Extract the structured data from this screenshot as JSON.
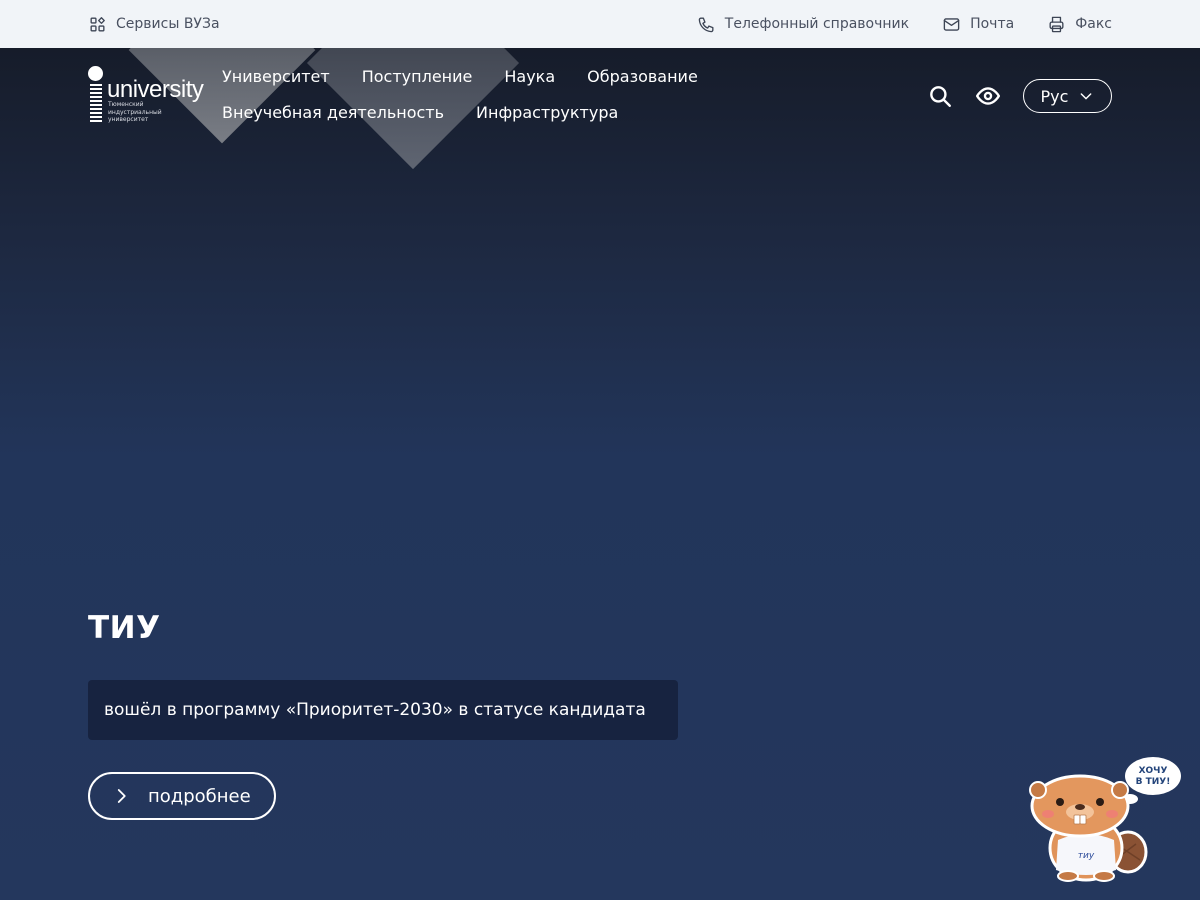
{
  "topbar": {
    "services_label": "Сервисы ВУЗа",
    "phonebook_label": "Телефонный справочник",
    "mail_label": "Почта",
    "fax_label": "Факс"
  },
  "logo": {
    "word": "university",
    "subtitle": "Тюменский индустриальный университет"
  },
  "nav": {
    "items": [
      "Университет",
      "Поступление",
      "Наука",
      "Образование",
      "Внеучебная деятельность",
      "Инфраструктура"
    ]
  },
  "header": {
    "lang_label": "Рус"
  },
  "hero": {
    "title": "ТИУ",
    "caption": "вошёл в программу «Приоритет-2030» в статусе кандидата",
    "more_label": "подробнее"
  },
  "mascot": {
    "bubble_line1": "ХОЧУ",
    "bubble_line2": "В ТИУ!",
    "shirt_text": "тиу"
  },
  "colors": {
    "topbar_bg": "#f1f4f8",
    "hero_bg": "#24375d",
    "caption_bg": "#172340",
    "text_light": "#ffffff"
  },
  "icons": {
    "services": "grid-apps-icon",
    "phonebook": "phone-icon",
    "mail": "mail-icon",
    "fax": "printer-icon",
    "search": "search-icon",
    "accessibility": "eye-icon",
    "lang_dropdown": "chevron-down-icon",
    "more": "chevron-right-icon"
  }
}
